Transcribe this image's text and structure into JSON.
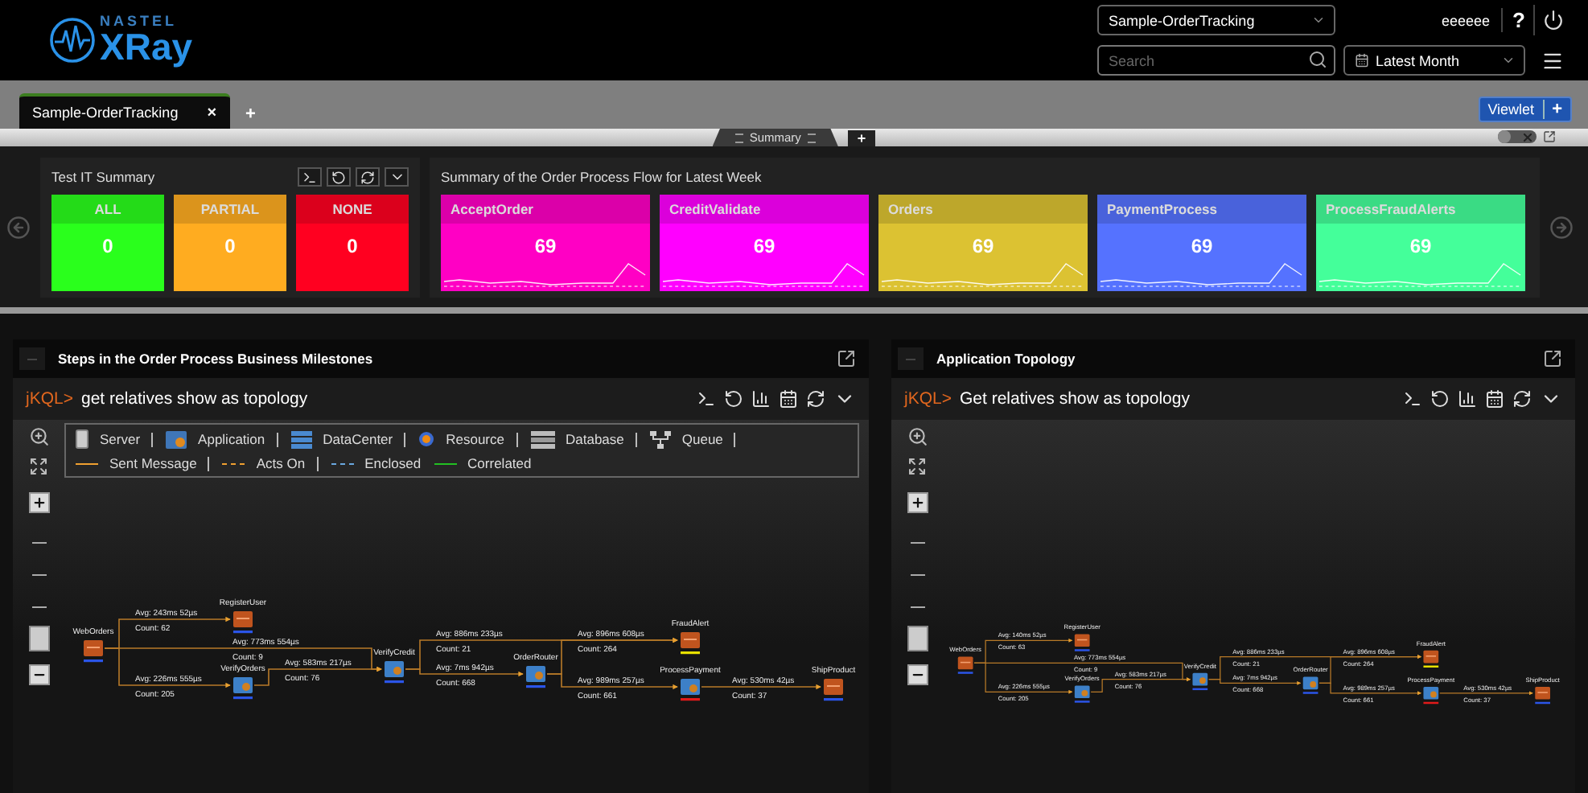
{
  "header": {
    "logo_small": "NASTEL",
    "logo_big": "XRay",
    "dashboard_select": "Sample-OrderTracking",
    "user": "eeeeee",
    "help": "?",
    "search": {
      "placeholder": "Search"
    },
    "period_select": "Latest Month"
  },
  "tabs": [
    {
      "label": "Sample-OrderTracking",
      "selected": true,
      "close": "×"
    }
  ],
  "add_tab": "+",
  "viewlet_button": {
    "label": "Viewlet",
    "plus": "+"
  },
  "section_tab": {
    "label": "Summary",
    "add": "+"
  },
  "strip_toggle": {
    "on": false
  },
  "summary_panels": [
    {
      "kind": "status",
      "title": "Test IT Summary",
      "tiles": [
        {
          "label": "ALL",
          "value": "0",
          "color": "#2aff1c"
        },
        {
          "label": "PARTIAL",
          "value": "0",
          "color": "#ffac20"
        },
        {
          "label": "NONE",
          "value": "0",
          "color": "#ff0020"
        }
      ]
    },
    {
      "kind": "trend",
      "title": "Summary of the Order Process Flow for Latest Week",
      "tiles": [
        {
          "label": "AcceptOrder",
          "value": "69",
          "color": "#ff00c4"
        },
        {
          "label": "CreditValidate",
          "value": "69",
          "color": "#ff00ff"
        },
        {
          "label": "Orders",
          "value": "69",
          "color": "#dcc232"
        },
        {
          "label": "PaymentProcess",
          "value": "69",
          "color": "#5572ff"
        },
        {
          "label": "ProcessFraudAlerts",
          "value": "69",
          "color": "#44ff9a"
        }
      ]
    }
  ],
  "topology_panels": [
    {
      "title": "Steps in the Order Process Business Milestones",
      "prompt": "jKQL>",
      "query": "get relatives show as topology",
      "slider": {
        "level": 0.1
      },
      "legend": [
        {
          "kind": "server",
          "label": "Server"
        },
        {
          "kind": "application",
          "label": "Application"
        },
        {
          "kind": "datacenter",
          "label": "DataCenter"
        },
        {
          "kind": "resource",
          "label": "Resource"
        },
        {
          "kind": "database",
          "label": "Database"
        },
        {
          "kind": "queue",
          "label": "Queue"
        },
        {
          "kind": "line",
          "label": "Sent Message",
          "color": "#f0a030",
          "dashed": false
        },
        {
          "kind": "line",
          "label": "Acts On",
          "color": "#f0a030",
          "dashed": true
        },
        {
          "kind": "line",
          "label": "Enclosed",
          "color": "#6aa8e0",
          "dashed": true
        },
        {
          "kind": "line",
          "label": "Correlated",
          "color": "#22c022",
          "dashed": false
        }
      ],
      "graph": {
        "nodes": [
          {
            "name": "WebOrders",
            "kind": "server",
            "color": "#2b55e8"
          },
          {
            "name": "RegisterUser",
            "kind": "server",
            "color": "#2b55e8"
          },
          {
            "name": "VerifyOrders",
            "kind": "application",
            "color": "#2b55e8"
          },
          {
            "name": "VerifyCredit",
            "kind": "application",
            "color": "#2b55e8"
          },
          {
            "name": "OrderRouter",
            "kind": "application",
            "color": "#2b55e8"
          },
          {
            "name": "FraudAlert",
            "kind": "server",
            "color": "#e8e000"
          },
          {
            "name": "ProcessPayment",
            "kind": "application",
            "color": "#e01a1a"
          },
          {
            "name": "ShipProduct",
            "kind": "server",
            "color": "#2b55e8"
          }
        ],
        "edges": [
          {
            "avg": "Avg: 243ms 52µs",
            "count": "Count: 62"
          },
          {
            "avg": "Avg: 773ms 554µs",
            "count": "Count: 9"
          },
          {
            "avg": "Avg: 226ms 555µs",
            "count": "Count: 205"
          },
          {
            "avg": "Avg: 583ms 217µs",
            "count": "Count: 76"
          },
          {
            "avg": "Avg: 886ms 233µs",
            "count": "Count: 21"
          },
          {
            "avg": "Avg: 7ms 942µs",
            "count": "Count: 668"
          },
          {
            "avg": "Avg: 896ms 608µs",
            "count": "Count: 264"
          },
          {
            "avg": "Avg: 989ms 257µs",
            "count": "Count: 661"
          },
          {
            "avg": "Avg: 530ms 42µs",
            "count": "Count: 37"
          }
        ]
      }
    },
    {
      "title": "Application Topology",
      "prompt": "jKQL>",
      "query": "Get relatives show as topology",
      "slider": {
        "level": 0.1
      },
      "graph": {
        "nodes": [
          {
            "name": "WebOrders",
            "kind": "server",
            "color": "#2b55e8"
          },
          {
            "name": "RegisterUser",
            "kind": "server",
            "color": "#2b55e8"
          },
          {
            "name": "VerifyOrders",
            "kind": "application",
            "color": "#2b55e8"
          },
          {
            "name": "VerifyCredit",
            "kind": "application",
            "color": "#2b55e8"
          },
          {
            "name": "OrderRouter",
            "kind": "application",
            "color": "#2b55e8"
          },
          {
            "name": "FraudAlert",
            "kind": "server",
            "color": "#e8e000"
          },
          {
            "name": "ProcessPayment",
            "kind": "application",
            "color": "#e01a1a"
          },
          {
            "name": "ShipProduct",
            "kind": "server",
            "color": "#2b55e8"
          }
        ],
        "edges": [
          {
            "avg": "Avg: 140ms 52µs",
            "count": "Count: 63"
          },
          {
            "avg": "Avg: 773ms 554µs",
            "count": "Count: 9"
          },
          {
            "avg": "Avg: 226ms 555µs",
            "count": "Count: 205"
          },
          {
            "avg": "Avg: 583ms 217µs",
            "count": "Count: 76"
          },
          {
            "avg": "Avg: 886ms 233µs",
            "count": "Count: 21"
          },
          {
            "avg": "Avg: 7ms 942µs",
            "count": "Count: 668"
          },
          {
            "avg": "Avg: 896ms 608µs",
            "count": "Count: 264"
          },
          {
            "avg": "Avg: 989ms 257µs",
            "count": "Count: 661"
          },
          {
            "avg": "Avg: 530ms 42µs",
            "count": "Count: 37"
          }
        ]
      }
    }
  ]
}
